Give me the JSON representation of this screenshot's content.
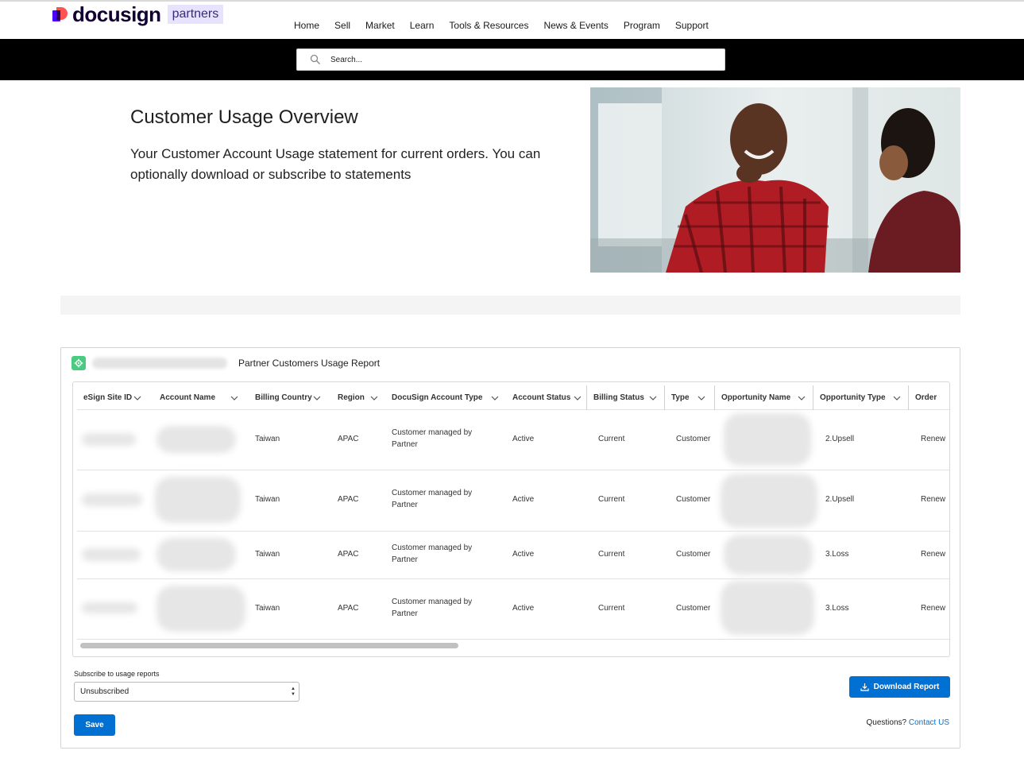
{
  "header": {
    "logo_text": "docusign",
    "logo_badge": "partners",
    "nav": [
      "Home",
      "Sell",
      "Market",
      "Learn",
      "Tools & Resources",
      "News & Events",
      "Program",
      "Support"
    ]
  },
  "search": {
    "placeholder": "Search..."
  },
  "hero": {
    "title": "Customer Usage Overview",
    "description": "Your Customer Account Usage statement for current orders. You can optionally download or subscribe to statements"
  },
  "report": {
    "title": "Partner Customers Usage Report",
    "columns": [
      "eSign Site ID",
      "Account Name",
      "Billing Country",
      "Region",
      "DocuSign Account Type",
      "Account Status",
      "Billing Status",
      "Type",
      "Opportunity Name",
      "Opportunity Type",
      "Order"
    ],
    "rows": [
      {
        "billing_country": "Taiwan",
        "region": "APAC",
        "account_type_line1": "Customer managed by",
        "account_type_line2": "Partner",
        "account_status": "Active",
        "billing_status": "Current",
        "type": "Customer",
        "opportunity_type": "2.Upsell",
        "order": "Renew"
      },
      {
        "billing_country": "Taiwan",
        "region": "APAC",
        "account_type_line1": "Customer managed by",
        "account_type_line2": "Partner",
        "account_status": "Active",
        "billing_status": "Current",
        "type": "Customer",
        "opportunity_type": "2.Upsell",
        "order": "Renew"
      },
      {
        "billing_country": "Taiwan",
        "region": "APAC",
        "account_type_line1": "Customer managed by",
        "account_type_line2": "Partner",
        "account_status": "Active",
        "billing_status": "Current",
        "type": "Customer",
        "opportunity_type": "3.Loss",
        "order": "Renew"
      },
      {
        "billing_country": "Taiwan",
        "region": "APAC",
        "account_type_line1": "Customer managed by",
        "account_type_line2": "Partner",
        "account_status": "Active",
        "billing_status": "Current",
        "type": "Customer",
        "opportunity_type": "3.Loss",
        "order": "Renew"
      }
    ],
    "subscribe_label": "Subscribe to usage reports",
    "subscribe_value": "Unsubscribed",
    "save_label": "Save",
    "download_label": "Download Report",
    "questions_text": "Questions?",
    "contact_label": "Contact US"
  },
  "colors": {
    "accent": "#0070d2",
    "search_band": "#000000",
    "logo_purple": "#4c00ff",
    "logo_coral": "#ff5252"
  },
  "icons": [
    "search-icon",
    "gear-icon",
    "chevron-down-icon",
    "download-icon"
  ]
}
